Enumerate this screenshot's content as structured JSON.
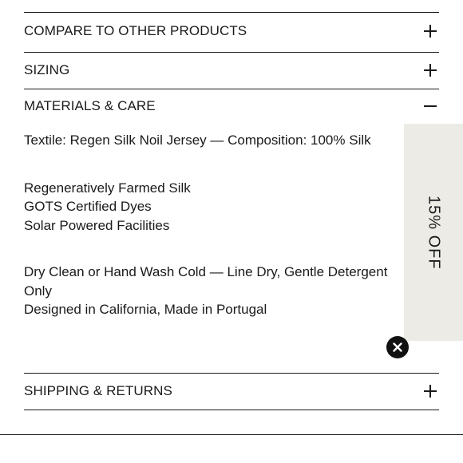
{
  "accordion": {
    "compare_label": "COMPARE TO OTHER PRODUCTS",
    "sizing_label": "SIZING",
    "materials_label": "MATERIALS & CARE",
    "shipping_label": "SHIPPING & RETURNS"
  },
  "materials": {
    "textile": "Textile: Regen Silk Noil Jersey — Composition: 100% Silk",
    "features": [
      "Regeneratively Farmed Silk",
      "GOTS Certified Dyes",
      "Solar Powered Facilities"
    ],
    "care": "Dry Clean or Hand Wash Cold — Line Dry, Gentle Detergent Only",
    "origin": "Designed in California, Made in Portugal"
  },
  "promo": {
    "label": "15% OFF"
  },
  "icons": {
    "expand": "plus-icon",
    "collapse": "minus-icon",
    "close": "close-icon"
  },
  "colors": {
    "text": "#1a1a1a",
    "promo_bg": "#ecebe6",
    "close_bg": "#111111"
  }
}
